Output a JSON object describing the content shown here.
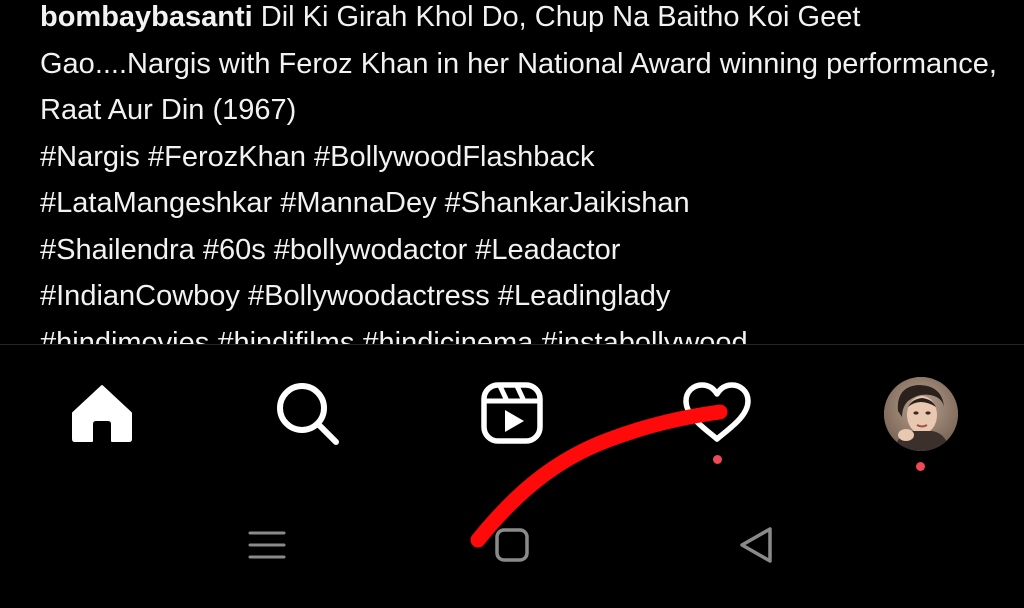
{
  "post": {
    "username": "bombaybasanti",
    "caption_text": " Dil Ki Girah Khol Do, Chup Na Baitho Koi Geet Gao....Nargis with Feroz Khan in her National Award winning performance, Raat Aur Din (1967)",
    "hashtag_lines": [
      "#Nargis #FerozKhan #BollywoodFlashback",
      "#LataMangeshkar #MannaDey #ShankarJaikishan",
      "#Shailendra #60s #bollywodactor #Leadactor",
      "#IndianCowboy #Bollywoodactress #Leadinglady",
      "#hindimovies #hindifilms #hindicinema #instabollywood"
    ]
  },
  "tab_bar": {
    "items": [
      {
        "name": "home",
        "icon": "home-icon",
        "active": true
      },
      {
        "name": "search",
        "icon": "search-icon"
      },
      {
        "name": "reels",
        "icon": "reels-icon"
      },
      {
        "name": "activity",
        "icon": "heart-icon",
        "has_notification": true
      },
      {
        "name": "profile",
        "icon": "avatar",
        "has_notification": true
      }
    ],
    "notification_dot_color": "#ed4956"
  },
  "system_nav": {
    "buttons": [
      {
        "name": "recents",
        "icon": "menu-lines-icon"
      },
      {
        "name": "home",
        "icon": "square-icon"
      },
      {
        "name": "back",
        "icon": "triangle-back-icon"
      }
    ]
  },
  "overlay": {
    "stroke_color": "#ff0a0a",
    "shape": "hand-drawn red stroke"
  }
}
